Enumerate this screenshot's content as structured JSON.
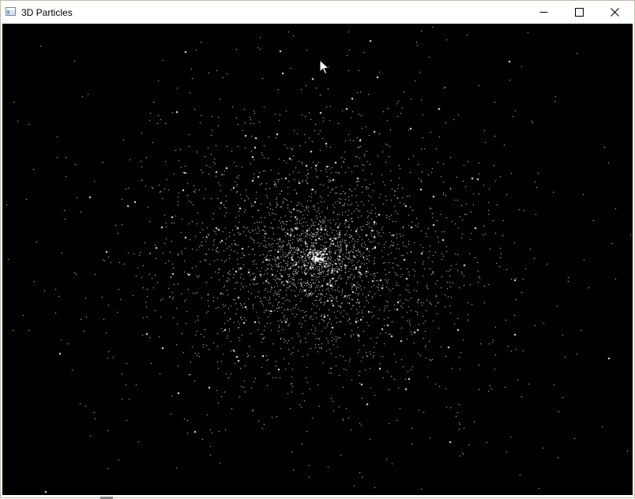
{
  "window": {
    "title": "3D Particles",
    "app_icon": "window-app-icon",
    "controls": {
      "minimize_icon": "minimize-icon",
      "maximize_icon": "maximize-icon",
      "close_icon": "close-icon"
    }
  },
  "scene": {
    "background_color": "#000000",
    "particle_color": "#ffffff",
    "cursor_icon": "arrow-cursor-icon"
  }
}
